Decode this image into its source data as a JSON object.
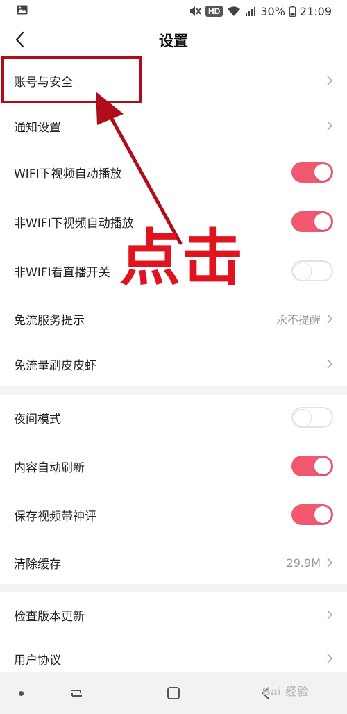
{
  "status_bar": {
    "hd": "HD",
    "battery": "30%",
    "time": "21:09",
    "icons": [
      "gallery-icon",
      "mute-icon",
      "wifi-icon",
      "signal-icon",
      "battery-icon"
    ]
  },
  "header": {
    "title": "设置",
    "back_icon": "back-chevron-icon"
  },
  "settings": {
    "account": {
      "label": "账号与安全"
    },
    "notify": {
      "label": "通知设置"
    },
    "wifi_autoplay": {
      "label": "WIFI下视频自动播放",
      "on": true
    },
    "nonwifi_autoplay": {
      "label": "非WIFI下视频自动播放",
      "on": true
    },
    "nonwifi_live": {
      "label": "非WIFI看直播开关",
      "on": false
    },
    "free_flow_tip": {
      "label": "免流服务提示",
      "value": "永不提醒"
    },
    "free_flow_pipixia": {
      "label": "免流量刷皮皮虾"
    },
    "night_mode": {
      "label": "夜间模式",
      "on": false
    },
    "auto_refresh": {
      "label": "内容自动刷新",
      "on": true
    },
    "save_video_comment": {
      "label": "保存视频带神评",
      "on": true
    },
    "clear_cache": {
      "label": "清除缓存",
      "value": "29.9M"
    },
    "check_update": {
      "label": "检查版本更新"
    },
    "user_agreement": {
      "label": "用户协议"
    }
  },
  "annotation": {
    "text": "点击",
    "color": "#e0141f",
    "box_color": "#b00d1b"
  },
  "colors": {
    "toggle_on": "#f1586f",
    "toggle_off_border": "#e3e3e3",
    "divider": "#f3f3f3"
  },
  "watermark": "Bai 经验"
}
